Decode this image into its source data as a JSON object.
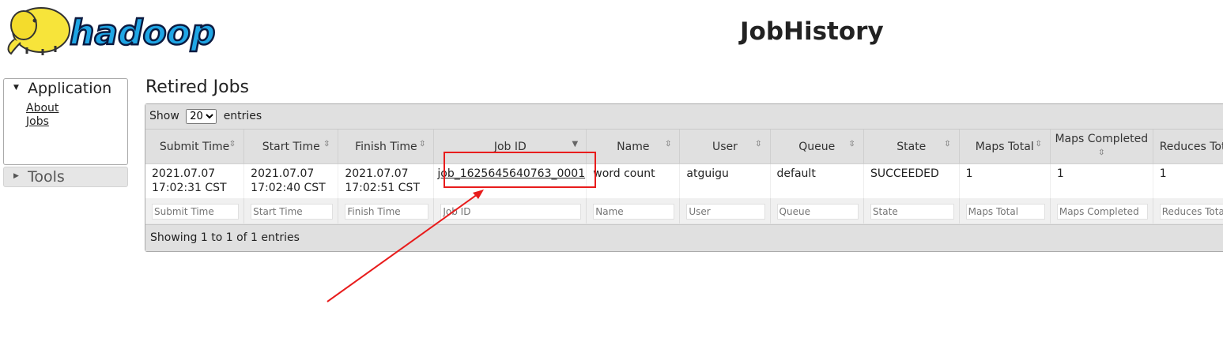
{
  "header": {
    "title": "JobHistory",
    "logo_text": "hadoop"
  },
  "sidebar": {
    "sections": [
      {
        "label": "Application",
        "expanded": true,
        "links": [
          {
            "label": "About"
          },
          {
            "label": "Jobs"
          }
        ]
      },
      {
        "label": "Tools",
        "expanded": false
      }
    ]
  },
  "main": {
    "section_title": "Retired Jobs",
    "length_menu": {
      "prefix": "Show",
      "value": "20",
      "options": [
        "20"
      ],
      "suffix": "entries"
    },
    "table": {
      "columns": [
        "Submit Time",
        "Start Time",
        "Finish Time",
        "Job ID",
        "Name",
        "User",
        "Queue",
        "State",
        "Maps Total",
        "Maps Completed",
        "Reduces Total"
      ],
      "rows": [
        {
          "submit_time": "2021.07.07 17:02:31 CST",
          "start_time": "2021.07.07 17:02:40 CST",
          "finish_time": "2021.07.07 17:02:51 CST",
          "job_id": "job_1625645640763_0001",
          "name": "word count",
          "user": "atguigu",
          "queue": "default",
          "state": "SUCCEEDED",
          "maps_total": "1",
          "maps_completed": "1",
          "reduces_total": "1"
        }
      ],
      "filter_placeholders": [
        "Submit Time",
        "Start Time",
        "Finish Time",
        "Job ID",
        "Name",
        "User",
        "Queue",
        "State",
        "Maps Total",
        "Maps Completed",
        "Reduces Total"
      ]
    },
    "info": "Showing 1 to 1 of 1 entries"
  },
  "colors": {
    "annotation": "#e81c1c",
    "logo_blue": "#1fa6e5",
    "logo_yellow": "#f7e43a"
  }
}
